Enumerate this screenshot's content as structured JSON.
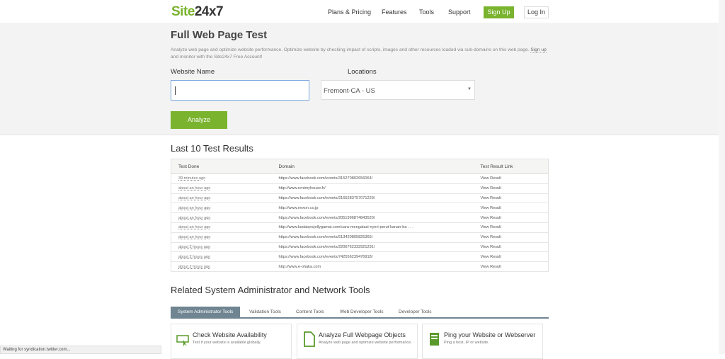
{
  "nav": {
    "logo_a": "Site",
    "logo_b": "24x7",
    "items": [
      "Plans & Pricing",
      "Features",
      "Tools",
      "Support"
    ],
    "signup": "Sign Up",
    "login": "Log In"
  },
  "hero": {
    "title": "Full Web Page Test",
    "desc": "Analyze web page and optimize website performance. Optimize website by checking impact of scripts, images and other resources loaded via sub-domains on this web page.",
    "signup_link": "Sign up",
    "desc_tail": "and monitor with the Site24x7 Free Account!",
    "website_label": "Website Name",
    "website_value": "",
    "locations_label": "Locations",
    "location_value": "Fremont-CA - US",
    "analyze": "Analyze"
  },
  "results": {
    "title": "Last 10 Test Results",
    "headers": [
      "Test Done",
      "Domain",
      "Test Result Link"
    ],
    "rows": [
      [
        "39 minutes ago",
        "https://www.facebook.com/events/315270802656064/",
        "View Result"
      ],
      [
        "about an hour ago",
        "http://www.rentmyhouse.fr/",
        "View Result"
      ],
      [
        "about an hour ago",
        "https://www.facebook.com/events/2165283757071229/",
        "View Result"
      ],
      [
        "about an hour ago",
        "http://www.nexon.co.jp",
        "View Result"
      ],
      [
        "about an hour ago",
        "https://www.facebook.com/events/2051996874843520/",
        "View Result"
      ],
      [
        "about an hour ago",
        "http://www.kedaiqncjellygamat.com/cara-mengatasi-nyeri-perut-kanan-ba . . .",
        "View Result"
      ],
      [
        "about an hour ago",
        "https://www.facebook.com/events/513420805825365/",
        "View Result"
      ],
      [
        "about 2 hours ago",
        "https://www.facebook.com/events/2206762332921291/",
        "View Result"
      ],
      [
        "about 2 hours ago",
        "https://www.facebook.com/events/742556239476918/",
        "View Result"
      ],
      [
        "about 2 hours ago",
        "http://www.e-ohaka.com",
        "View Result"
      ]
    ]
  },
  "related": {
    "title": "Related System Administrator and Network Tools",
    "tabs": [
      "System Administrator Tools",
      "Validation Tools",
      "Content Tools",
      "Web Developer Tools",
      "Developer Tools"
    ],
    "cards": [
      {
        "title": "Check Website Availability",
        "desc": "Test if your website is available globally."
      },
      {
        "title": "Analyze Full Webpage Objects",
        "desc": "Analyze web page and optimize website performance."
      },
      {
        "title": "Ping your Website or Webserver",
        "desc": "Ping a host, IP or website."
      }
    ]
  },
  "status": "Waiting for syndication.twitter.com..."
}
